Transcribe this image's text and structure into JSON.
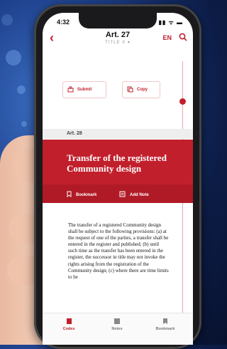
{
  "status": {
    "time": "4:32",
    "icons": "▮▮ ᯤ ▬"
  },
  "nav": {
    "title": "Art. 27",
    "subtitle": "TITLE X",
    "language": "EN"
  },
  "actions": {
    "submit_label": "Submit",
    "copy_label": "Copy"
  },
  "article_label": "Art. 28",
  "hero": {
    "title": "Transfer of the registered Community design",
    "bookmark_label": "Bookmark",
    "add_note_label": "Add Note"
  },
  "body_text": "The transfer of a registered Community design shall be subject to the following provisions: (a) at the request of one of the parties, a transfer shall be entered in the register and published; (b) until such time as the transfer has been entered in the register, the successor in title may not invoke the rights arising from the registration of the Community design; (c) where there are time limits to be",
  "tabs": [
    {
      "label": "Codes"
    },
    {
      "label": "Notes"
    },
    {
      "label": "Bookmark"
    }
  ],
  "colors": {
    "accent": "#c21f2c",
    "accent_dark": "#b01a26"
  }
}
